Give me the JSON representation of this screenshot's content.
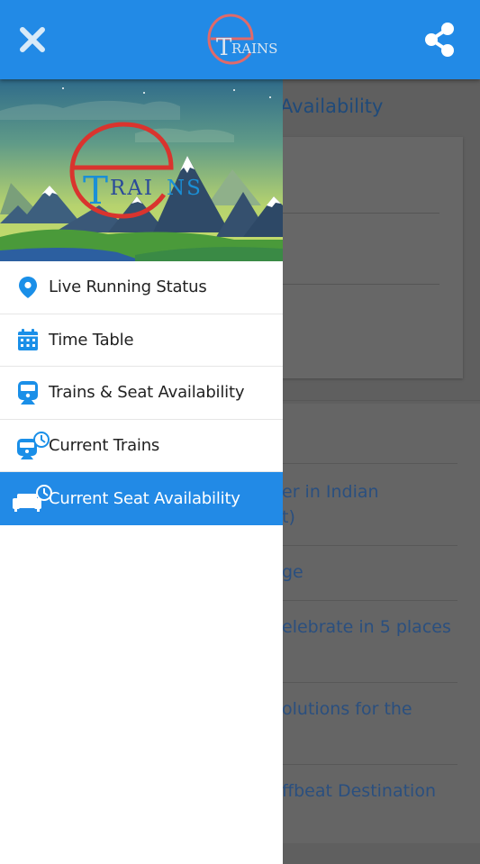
{
  "appbar": {
    "logo_letter": "e",
    "logo_text": "TRAINS",
    "close_icon": "close-icon",
    "share_icon": "share-icon"
  },
  "drawer": {
    "header_logo_letter": "e",
    "header_logo_text": "TRAINS",
    "items": [
      {
        "label": "Live Running Status",
        "icon": "map-pin-icon",
        "active": false
      },
      {
        "label": "Time Table",
        "icon": "calendar-icon",
        "active": false
      },
      {
        "label": "Trains & Seat Availability",
        "icon": "train-icon",
        "active": false
      },
      {
        "label": "Current Trains",
        "icon": "train-clock-icon",
        "active": false
      },
      {
        "label": "Current Seat Availability",
        "icon": "sofa-clock-icon",
        "active": true
      }
    ]
  },
  "background": {
    "title_visible": "Availability",
    "articles": [
      {
        "text_line1": "er in Indian",
        "text_line2": "t)"
      },
      {
        "text_line1": "ge",
        "text_line2": ""
      },
      {
        "text_line1": "elebrate in 5 places",
        "text_line2": ""
      },
      {
        "text_line1": "olutions for the",
        "text_line2": ""
      },
      {
        "text_line1": "ffbeat Destination",
        "text_line2": ""
      }
    ]
  },
  "colors": {
    "primary": "#228ae6",
    "icon_blue": "#1a8fe8",
    "logo_red": "#e06a6a",
    "scrim": "#5f5f5f"
  }
}
